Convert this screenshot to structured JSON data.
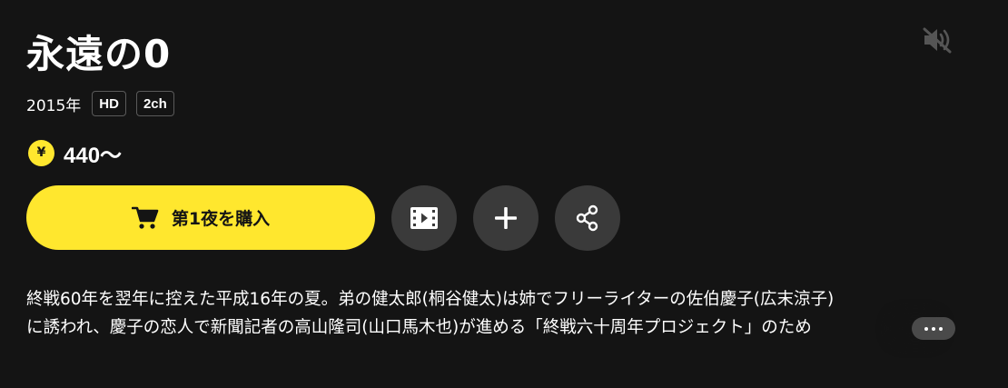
{
  "title": "永遠の0",
  "meta": {
    "year": "2015年",
    "badges": [
      "HD",
      "2ch"
    ]
  },
  "price": {
    "currency_symbol": "¥",
    "amount": "440〜"
  },
  "actions": {
    "buy_label": "第1夜を購入",
    "icons": [
      "trailer-icon",
      "add-to-list-icon",
      "share-icon",
      "mute-icon",
      "cart-icon"
    ]
  },
  "description": {
    "line1": "終戦60年を翌年に控えた平成16年の夏。弟の健太郎(桐谷健太)は姉でフリーライターの佐伯慶子(広末涼子)",
    "line2": "に誘われ、慶子の恋人で新聞記者の高山隆司(山口馬木也)が進める「終戦六十周年プロジェクト」のため"
  },
  "colors": {
    "background": "#141414",
    "accent": "#ffe72e",
    "circle_button": "#3a3a3a",
    "muted_icon": "#555555"
  }
}
